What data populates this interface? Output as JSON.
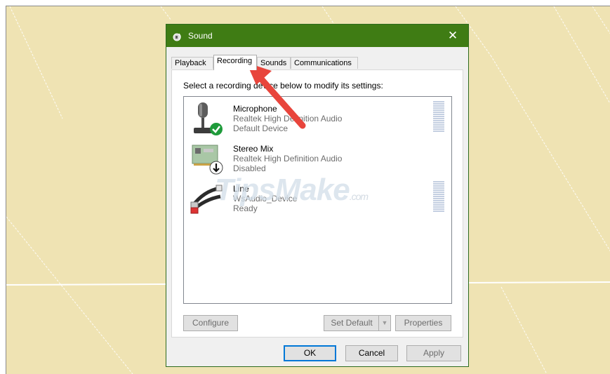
{
  "window": {
    "title": "Sound",
    "close_glyph": "✕",
    "titlebar_color": "#3f7c14"
  },
  "tabs": [
    {
      "label": "Playback",
      "active": false
    },
    {
      "label": "Recording",
      "active": true
    },
    {
      "label": "Sounds",
      "active": false
    },
    {
      "label": "Communications",
      "active": false
    }
  ],
  "instruction": "Select a recording device below to modify its settings:",
  "devices": [
    {
      "name": "Microphone",
      "driver": "Realtek High Definition Audio",
      "status": "Default Device",
      "icon": "microphone-icon",
      "badge": "green-check-icon"
    },
    {
      "name": "Stereo Mix",
      "driver": "Realtek High Definition Audio",
      "status": "Disabled",
      "icon": "sound-card-icon",
      "badge": "down-arrow-icon"
    },
    {
      "name": "Line",
      "driver": "WsAudio_Device",
      "status": "Ready",
      "icon": "audio-cable-icon"
    }
  ],
  "buttons": {
    "configure": "Configure",
    "set_default": "Set Default",
    "set_default_arrow": "▼",
    "properties": "Properties",
    "ok": "OK",
    "cancel": "Cancel",
    "apply": "Apply"
  },
  "watermark": {
    "text": "TipsMake",
    "suffix": ".com"
  },
  "colors": {
    "desktop": "#efe3b3",
    "accent_arrow": "#e8453c",
    "focus_border": "#0078d7"
  }
}
